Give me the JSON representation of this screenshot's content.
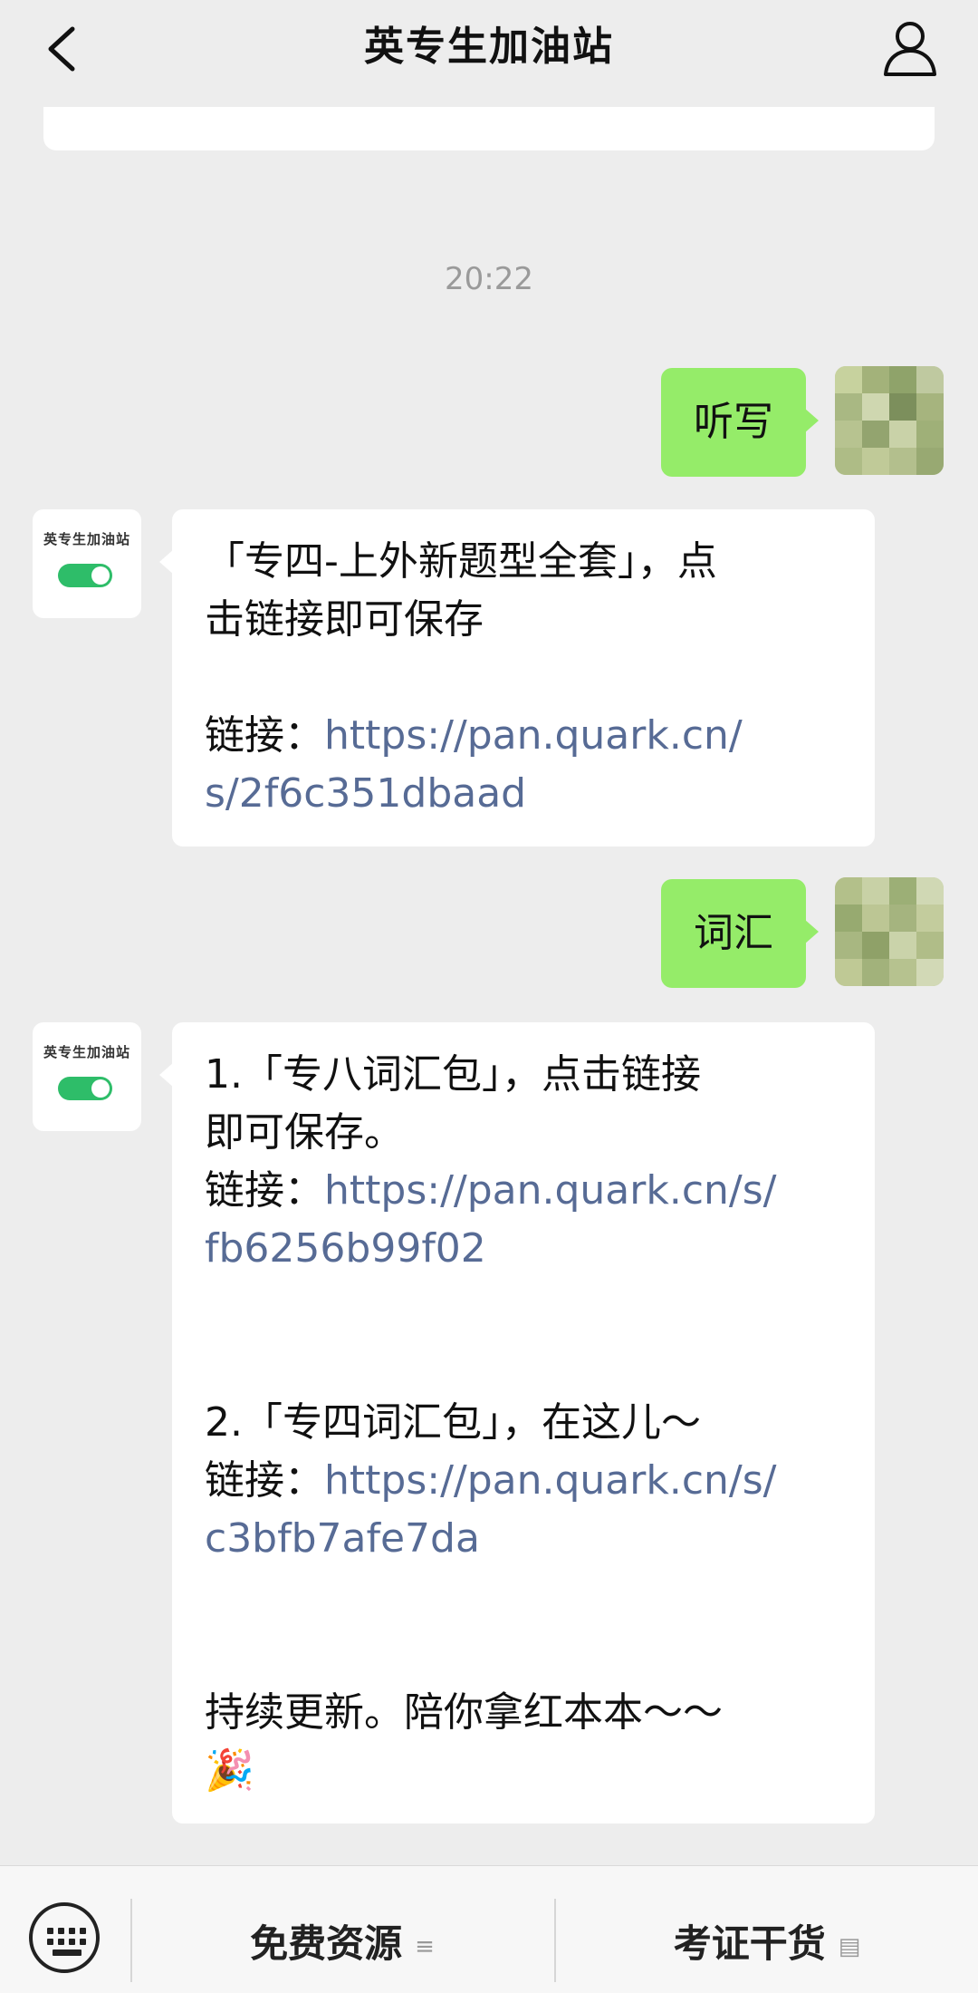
{
  "header": {
    "title": "英专生加油站",
    "back_icon": "chevron-left-icon",
    "profile_icon": "user-icon"
  },
  "timestamp": "20:22",
  "bot_avatar": {
    "name": "英专生加油站"
  },
  "messages": [
    {
      "side": "out",
      "text": "听写"
    },
    {
      "side": "in",
      "line1": "「专四-上外新题型全套」，点",
      "line2": "击链接即可保存",
      "link_label": "链接：",
      "link_line1": "https://pan.quark.cn/",
      "link_line2": "s/2f6c351dbaad"
    },
    {
      "side": "out",
      "text": "词汇"
    },
    {
      "side": "in",
      "item1_line1": "1.「专八词汇包」，点击链接",
      "item1_line2": "即可保存。",
      "item1_link_label": "链接：",
      "item1_link_line1": "https://pan.quark.cn/s/",
      "item1_link_line2": "fb6256b99f02",
      "item2_line1": "2.「专四词汇包」，在这儿～",
      "item2_link_label": "链接：",
      "item2_link_line1": "https://pan.quark.cn/s/",
      "item2_link_line2": "c3bfb7afe7da",
      "closing": "持续更新。陪你拿红本本～～",
      "emoji": "🎉"
    }
  ],
  "bottom_bar": {
    "keyboard_icon": "keyboard-icon",
    "menu1": "免费资源",
    "menu1_glyph": "≡",
    "menu2": "考证干货",
    "menu2_glyph": "▤"
  },
  "colors": {
    "background": "#ededed",
    "bubble_out": "#95ec69",
    "bubble_in": "#ffffff",
    "link": "#576b95",
    "toggle": "#2ebd69"
  }
}
